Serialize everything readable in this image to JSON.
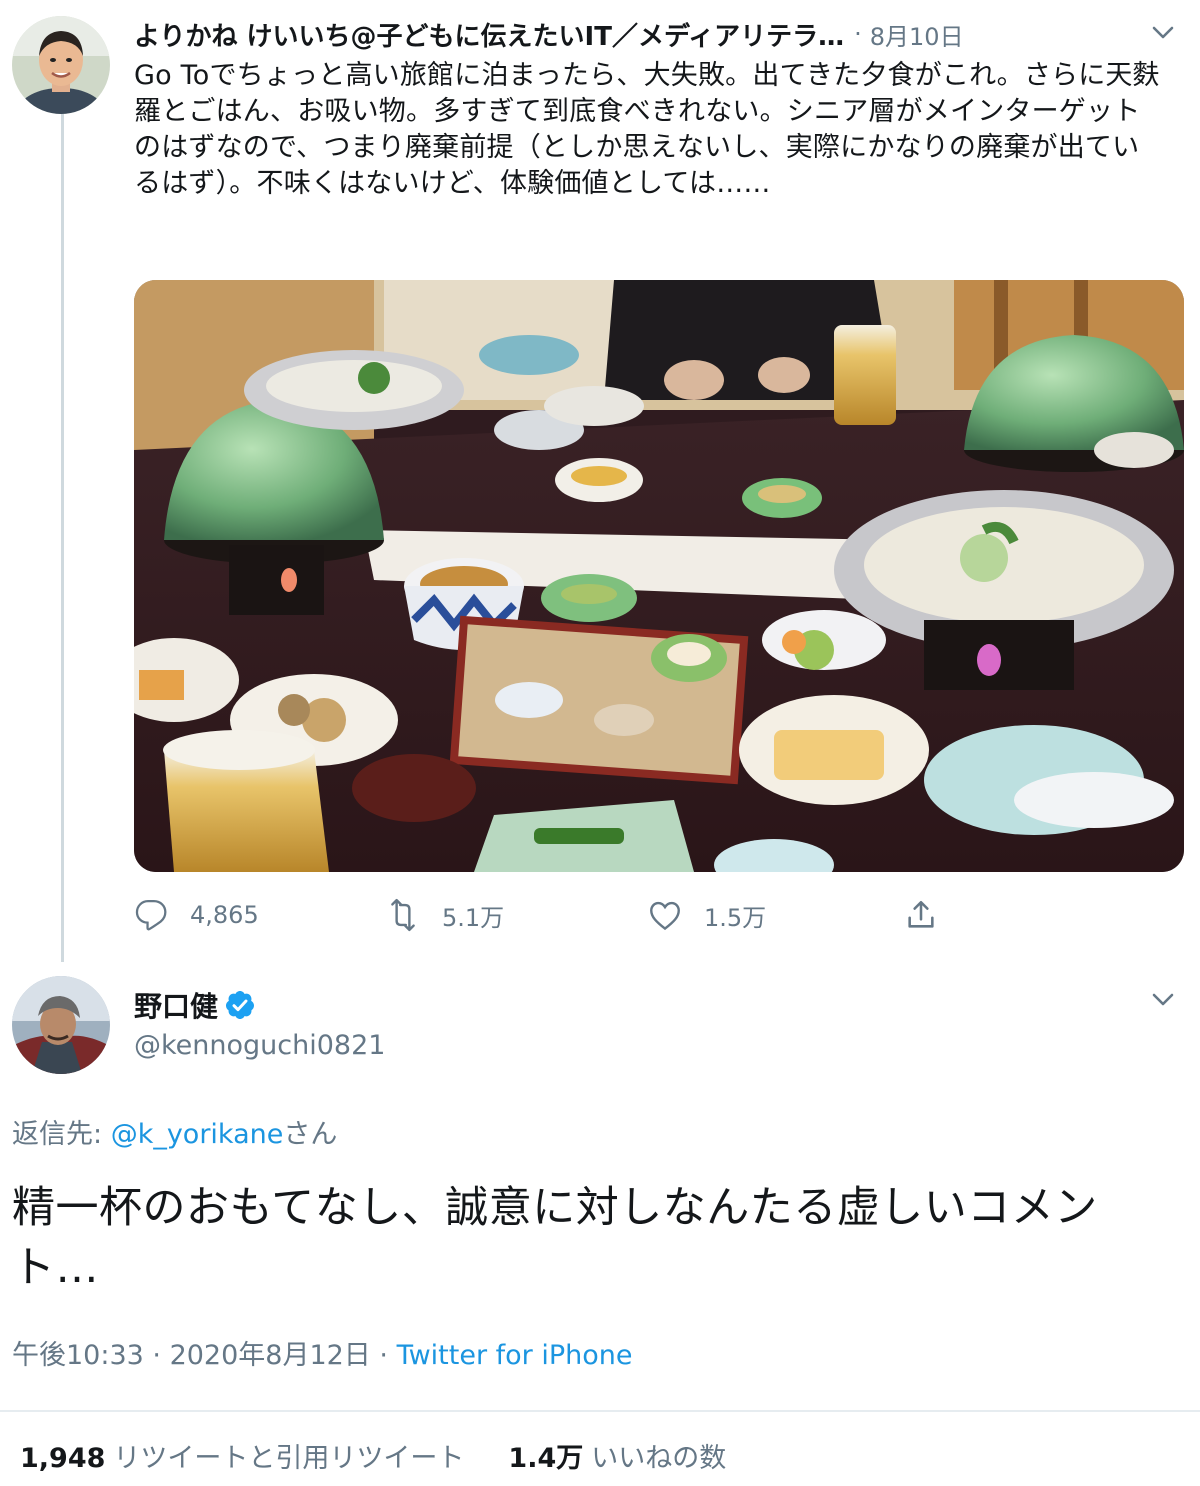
{
  "parent_tweet": {
    "author_name": "よりかね けいいち@子どもに伝えたいIT／メディアリテラ…",
    "separator": "·",
    "date": "8月10日",
    "text": "Go Toでちょっと高い旅館に泊まったら、大失敗。出てきた夕食がこれ。さらに天麩羅とごはん、お吸い物。多すぎて到底食べきれない。シニア層がメインターゲットのはずなので、つまり廃棄前提（としか思えないし、実際にかなりの廃棄が出ているはず）。不味くはないけど、体験価値としては……",
    "actions": {
      "replies": "4,865",
      "retweets": "5.1万",
      "likes": "1.5万"
    }
  },
  "reply_tweet": {
    "author_name": "野口健",
    "handle": "@kennoguchi0821",
    "reply_label": "返信先: ",
    "reply_mention": "@k_yorikane",
    "reply_suffix": "さん",
    "text": "精一杯のおもてなし、誠意に対しなんたる虚しいコメント…",
    "time": "午後10:33",
    "dot": " · ",
    "date": "2020年8月12日",
    "source": "Twitter for iPhone",
    "retweet_count": "1,948",
    "retweet_label": "リツイートと引用リツイート",
    "like_count": "1.4万",
    "like_label": "いいねの数"
  },
  "colors": {
    "accent": "#1b95e0",
    "muted": "#657786",
    "text": "#14171a",
    "verified": "#1da1f2"
  },
  "icons": [
    "chevron-down-icon",
    "reply-icon",
    "retweet-icon",
    "like-icon",
    "share-icon",
    "verified-badge-icon"
  ]
}
